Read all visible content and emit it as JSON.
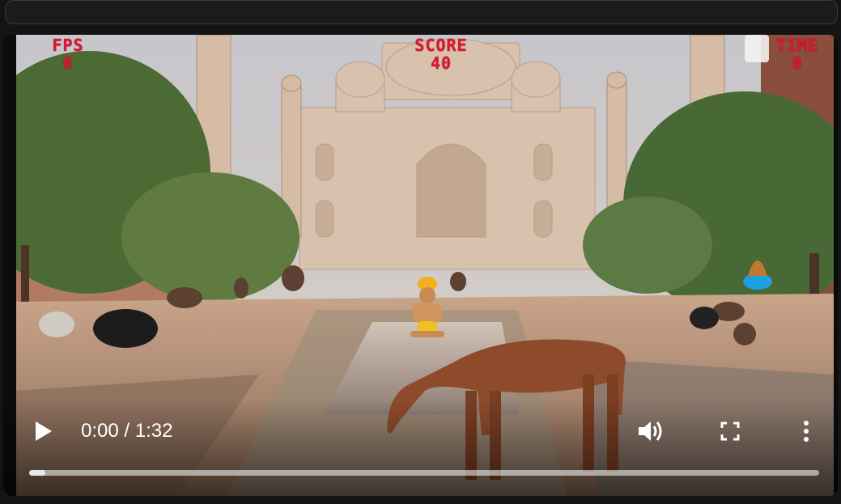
{
  "game": {
    "fps_label": "FPS",
    "fps_value": "0",
    "score_label": "SCORE",
    "score_value": "40",
    "time_label": "TIME",
    "time_value": "0"
  },
  "player": {
    "current_time": "0:00",
    "separator": " / ",
    "duration": "1:32",
    "progress_fraction": 0.02,
    "play_icon": "play-icon",
    "volume_icon": "volume-icon",
    "fullscreen_icon": "fullscreen-icon",
    "more_icon": "more-vertical-icon"
  },
  "colors": {
    "hud_red": "#e0152e",
    "page_bg": "#141414"
  }
}
